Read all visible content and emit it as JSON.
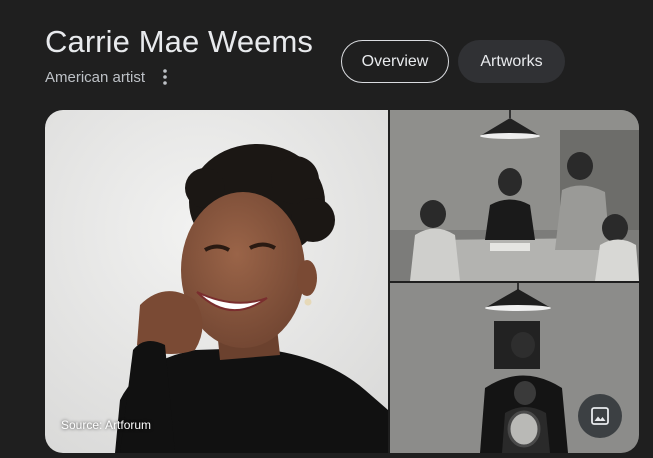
{
  "entity": {
    "title": "Carrie Mae Weems",
    "subtitle": "American artist"
  },
  "tabs": [
    {
      "label": "Overview",
      "selected": true
    },
    {
      "label": "Artworks",
      "selected": false
    }
  ],
  "gallery": {
    "source_label": "Source: Artforum"
  },
  "colors": {
    "background": "#1f1f1f",
    "title_text": "#e8eaed",
    "subtitle_text": "#bdc1c6",
    "tab_fill": "#303134",
    "tab_outline": "#dadce0"
  }
}
